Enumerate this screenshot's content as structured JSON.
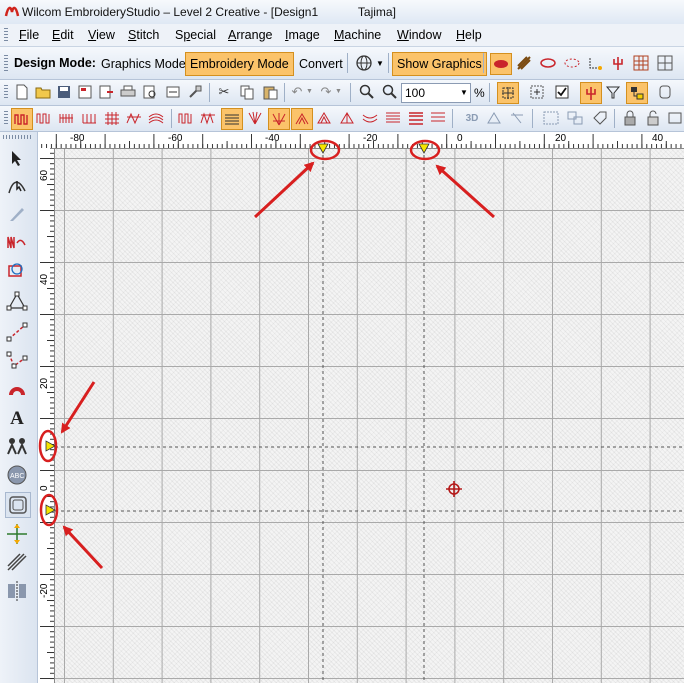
{
  "window": {
    "title": "Wilcom EmbroideryStudio – Level 2 Creative - [Design1            Tajima]"
  },
  "menu": [
    {
      "label": "File",
      "key": "F"
    },
    {
      "label": "Edit",
      "key": "E"
    },
    {
      "label": "View",
      "key": "V"
    },
    {
      "label": "Stitch",
      "key": "S"
    },
    {
      "label": "Special",
      "key": "p"
    },
    {
      "label": "Arrange",
      "key": "A"
    },
    {
      "label": "Image",
      "key": "I"
    },
    {
      "label": "Machine",
      "key": "M"
    },
    {
      "label": "Window",
      "key": "W"
    },
    {
      "label": "Help",
      "key": "H"
    }
  ],
  "mode_bar": {
    "design_mode_label": "Design Mode:",
    "graphics_mode": "Graphics Mode",
    "embroidery_mode": "Embroidery Mode",
    "convert": "Convert",
    "show_graphics": "Show Graphics"
  },
  "toolbar": {
    "zoom_value": "100",
    "zoom_unit": "%",
    "threed_label": "3D"
  },
  "rulers": {
    "horizontal_labels": [
      "-80",
      "-60",
      "-40",
      "-20",
      "0",
      "20",
      "40"
    ],
    "vertical_labels": [
      "60",
      "40",
      "20",
      "0",
      "-20"
    ]
  },
  "colors": {
    "active_mode": "#fbc36a",
    "annotation": "#d81f1f",
    "guide_marker": "#f5e400"
  },
  "icons": {
    "app": "wilcom-logo-icon",
    "guide_marker": "guide-triangle-icon",
    "hoop_center": "crosshair-icon"
  }
}
